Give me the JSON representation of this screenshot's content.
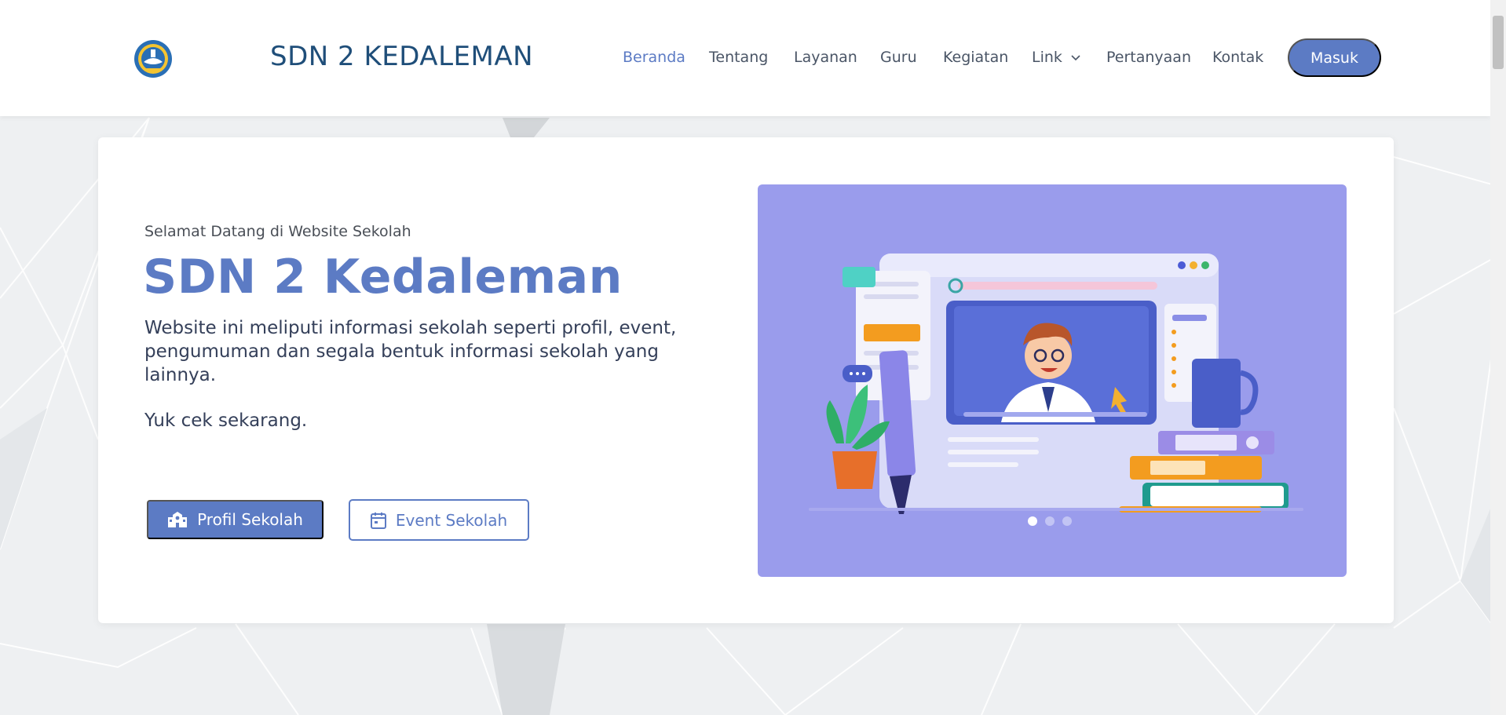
{
  "brand": {
    "name": "SDN 2 KEDALEMAN",
    "logo_icon": "tut-wuri-handayani-logo-icon"
  },
  "nav": {
    "items": [
      {
        "label": "Beranda",
        "active": true
      },
      {
        "label": "Tentang",
        "active": false
      },
      {
        "label": "Layanan",
        "active": false
      },
      {
        "label": "Guru",
        "active": false
      },
      {
        "label": "Kegiatan",
        "active": false
      },
      {
        "label": "Link",
        "active": false,
        "has_dropdown": true
      },
      {
        "label": "Pertanyaan",
        "active": false
      },
      {
        "label": "Kontak",
        "active": false
      }
    ],
    "login_label": "Masuk"
  },
  "hero": {
    "greeting": "Selamat Datang di Website Sekolah",
    "title": "SDN 2 Kedaleman",
    "description": "Website ini meliputi informasi sekolah seperti profil, event, pengumuman dan segala bentuk informasi sekolah yang lainnya.",
    "cta_text": "Yuk cek sekarang.",
    "buttons": {
      "profil": {
        "label": "Profil Sekolah",
        "icon": "school-icon"
      },
      "event": {
        "label": "Event Sekolah",
        "icon": "calendar-icon"
      }
    },
    "carousel": {
      "slides": 3,
      "active_index": 0
    }
  },
  "colors": {
    "accent": "#5c7bc4",
    "brand_text": "#1f4e79",
    "hero_image_bg": "#9a9cec"
  }
}
